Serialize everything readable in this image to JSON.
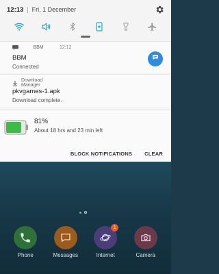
{
  "status": {
    "time": "12:13",
    "separator": "|",
    "date": "Fri, 1 December"
  },
  "quick_toggles": [
    {
      "name": "wifi-icon",
      "active": true
    },
    {
      "name": "volume-icon",
      "active": true
    },
    {
      "name": "bluetooth-icon",
      "active": false
    },
    {
      "name": "screen-rotation-icon",
      "active": true
    },
    {
      "name": "flashlight-icon",
      "active": false
    },
    {
      "name": "airplane-icon",
      "active": false
    }
  ],
  "notifications": {
    "bbm": {
      "app": "BBM",
      "time": "12:12",
      "title": "BBM",
      "text": "Connected"
    },
    "download": {
      "app": "Download Manager",
      "title": "pkvgames-1.apk",
      "text": "Download complete."
    },
    "battery": {
      "percent": "81%",
      "text": "About 18 hrs and 23 min left",
      "level": 0.81
    }
  },
  "actions": {
    "block": "BLOCK NOTIFICATIONS",
    "clear": "CLEAR"
  },
  "dock": [
    {
      "label": "Phone",
      "icon": "phone-icon",
      "color": "#2f6f3a"
    },
    {
      "label": "Messages",
      "icon": "messages-icon",
      "color": "#9c5a1c"
    },
    {
      "label": "Internet",
      "icon": "internet-icon",
      "color": "#4b3d78",
      "badge": "1"
    },
    {
      "label": "Camera",
      "icon": "camera-icon",
      "color": "#6a3a4a"
    }
  ],
  "colors": {
    "accent": "#2aa6c9",
    "reply": "#2d8be0",
    "battery_green": "#3fb94a"
  }
}
